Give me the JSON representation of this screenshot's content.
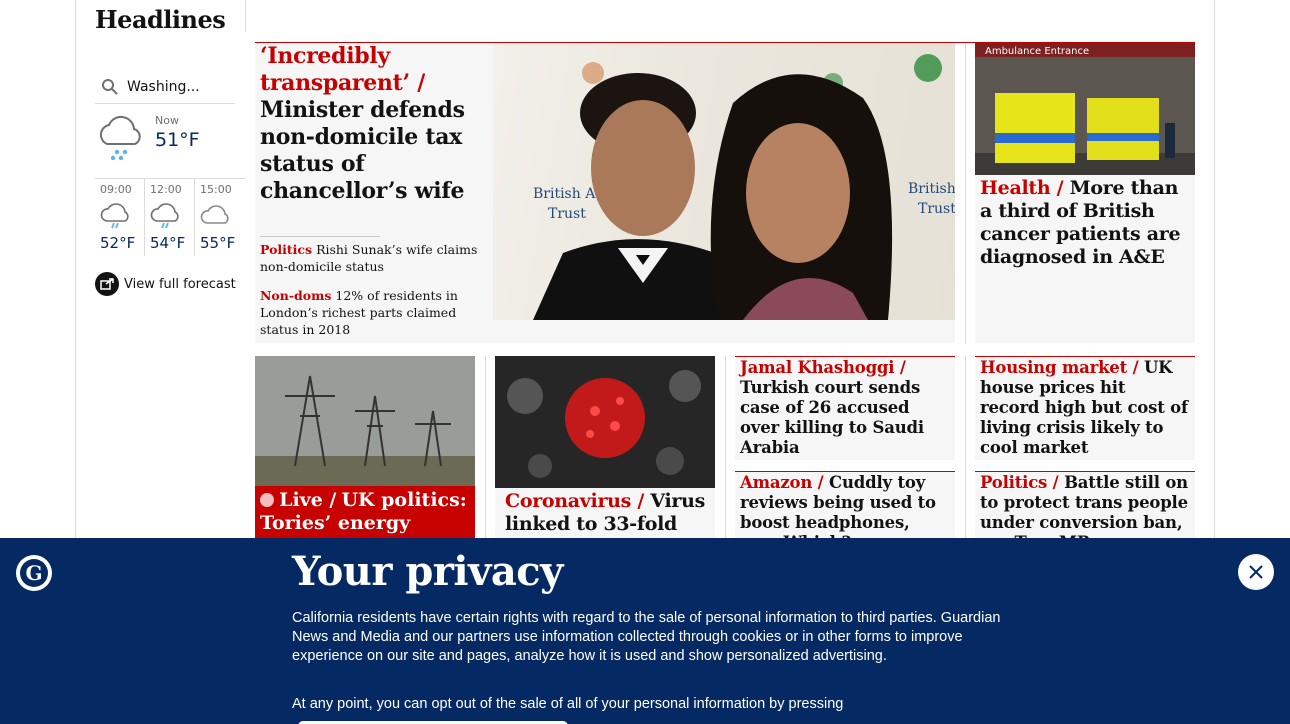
{
  "section": {
    "title": "Headlines"
  },
  "weather": {
    "location": "Washing...",
    "now_label": "Now",
    "now_temp": "51°F",
    "forecast": [
      {
        "time": "09:00",
        "temp": "52°F",
        "icon": "rain-cloud-icon"
      },
      {
        "time": "12:00",
        "temp": "54°F",
        "icon": "rain-cloud-icon"
      },
      {
        "time": "15:00",
        "temp": "55°F",
        "icon": "cloud-icon"
      }
    ],
    "view_full": "View full forecast"
  },
  "hero": {
    "kicker": "‘Incredibly transparent’ /",
    "headline": "Minister defends non-domicile tax status of chancellor’s wife",
    "sublinks": [
      {
        "kicker": "Politics",
        "text": "Rishi Sunak’s wife claims non-domicile status"
      },
      {
        "kicker": "Non-doms",
        "text": "12% of residents in London’s richest parts claimed status in 2018"
      }
    ],
    "image_sign_text": [
      "British Asian",
      "Trust",
      "British",
      "Trust"
    ]
  },
  "health": {
    "image_sign": "Ambulance Entrance",
    "kicker": "Health /",
    "headline": "More than a third of British cancer patients are diagnosed in A&E"
  },
  "cards": [
    {
      "kicker": "Live /",
      "headline": "UK politics: Tories’ energy strategy",
      "live": true
    },
    {
      "kicker": "Coronavirus /",
      "headline": "Virus linked to 33-fold"
    },
    {
      "kicker": "Jamal Khashoggi /",
      "headline": "Turkish court sends case of 26 accused over killing to Saudi Arabia"
    },
    {
      "kicker": "Housing market /",
      "headline": "UK house prices hit record high but cost of living crisis likely to cool market"
    },
    {
      "kicker": "Amazon /",
      "headline": "Cuddly toy reviews being used to boost headphones, says Which?"
    },
    {
      "kicker": "Politics /",
      "headline": "Battle still on to protect trans people under conversion ban, say Tory MP"
    }
  ],
  "privacy": {
    "title": "Your privacy",
    "text": "California residents have certain rights with regard to the sale of personal information to third parties. Guardian News and Media and our partners use information collected through cookies or in other forms to improve experience on our site and pages, analyze how it is used and show personalized advertising.",
    "text2": "At any point, you can opt out of the sale of all of your personal information by pressing"
  },
  "colors": {
    "news_red": "#c70000",
    "brand_blue": "#052962",
    "card_bg": "#f6f6f6"
  }
}
